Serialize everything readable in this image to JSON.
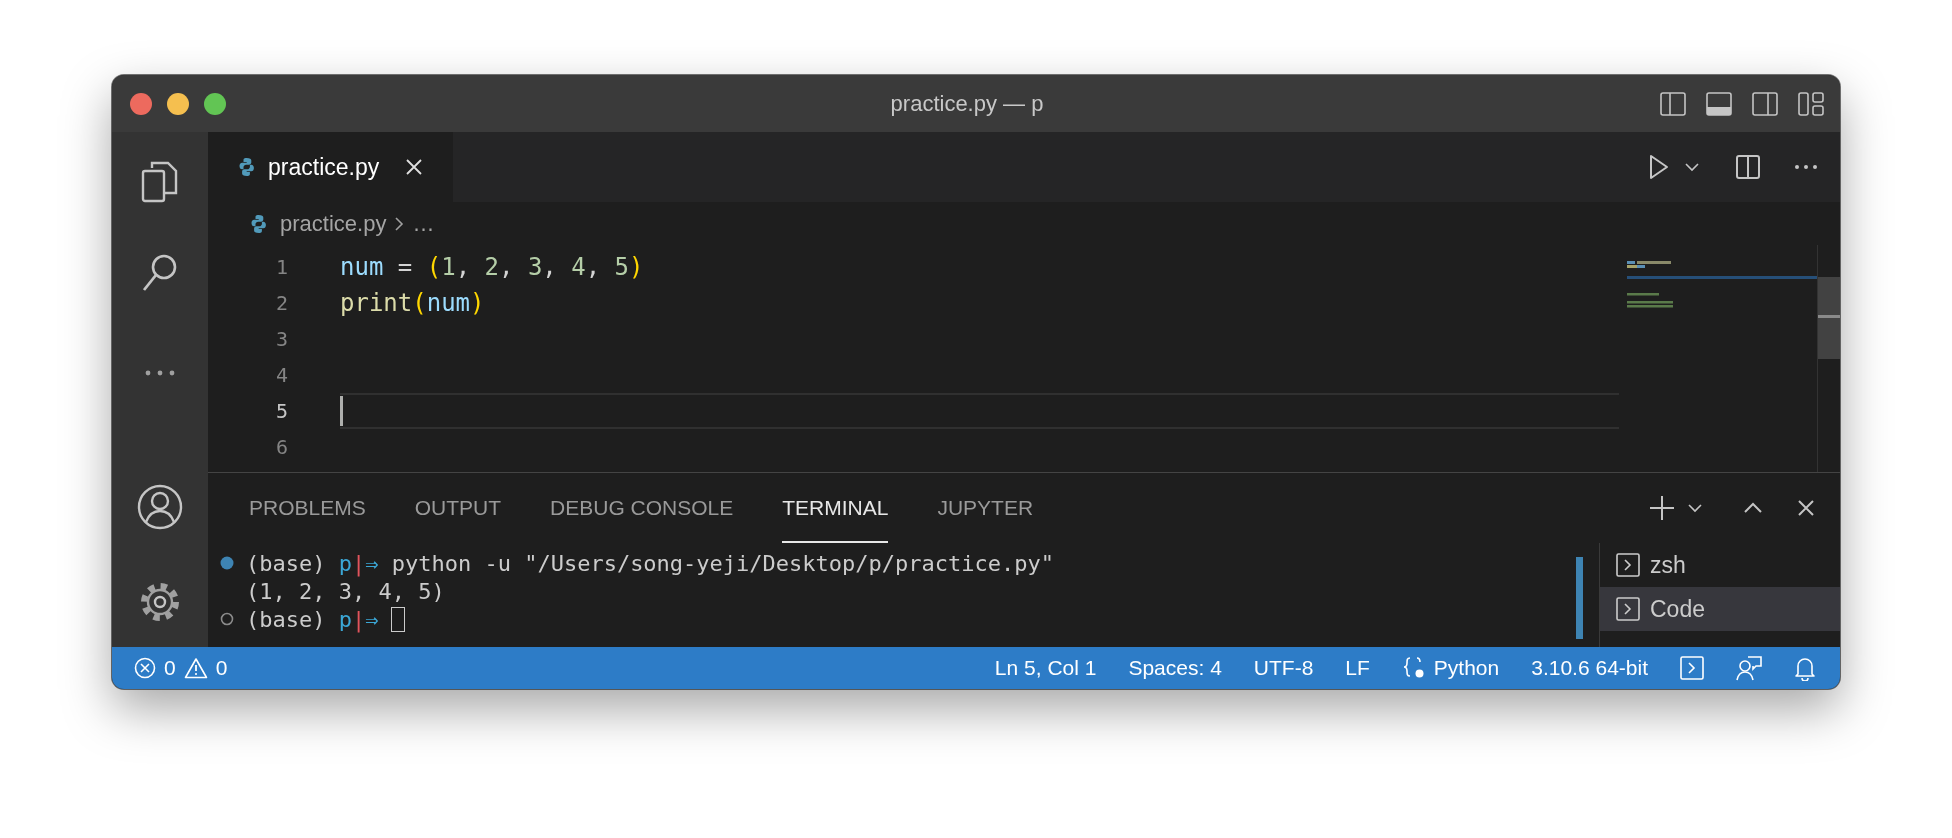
{
  "window": {
    "title": "practice.py — p"
  },
  "tabs": [
    {
      "label": "practice.py",
      "selected": true
    }
  ],
  "breadcrumb": [
    "practice.py",
    "…"
  ],
  "editor": {
    "lines": [
      {
        "number": "1",
        "current": false,
        "tokens": [
          {
            "text": "num",
            "kind": "variable"
          },
          {
            "text": " = ",
            "kind": "operator"
          },
          {
            "text": "(",
            "kind": "paren"
          },
          {
            "text": "1",
            "kind": "number"
          },
          {
            "text": ", ",
            "kind": "operator"
          },
          {
            "text": "2",
            "kind": "number"
          },
          {
            "text": ", ",
            "kind": "operator"
          },
          {
            "text": "3",
            "kind": "number"
          },
          {
            "text": ", ",
            "kind": "operator"
          },
          {
            "text": "4",
            "kind": "number"
          },
          {
            "text": ", ",
            "kind": "operator"
          },
          {
            "text": "5",
            "kind": "number"
          },
          {
            "text": ")",
            "kind": "paren"
          }
        ]
      },
      {
        "number": "2",
        "current": false,
        "tokens": [
          {
            "text": "print",
            "kind": "function"
          },
          {
            "text": "(",
            "kind": "paren"
          },
          {
            "text": "num",
            "kind": "variable"
          },
          {
            "text": ")",
            "kind": "paren"
          }
        ]
      },
      {
        "number": "3",
        "current": false
      },
      {
        "number": "4",
        "current": false
      },
      {
        "number": "5",
        "current": true
      },
      {
        "number": "6",
        "current": false
      }
    ]
  },
  "panel": {
    "tabs": [
      {
        "label": "PROBLEMS",
        "selected": false
      },
      {
        "label": "OUTPUT",
        "selected": false
      },
      {
        "label": "DEBUG CONSOLE",
        "selected": false
      },
      {
        "label": "TERMINAL",
        "selected": true
      },
      {
        "label": "JUPYTER",
        "selected": false
      }
    ],
    "terminal": [
      {
        "succeeded": true,
        "cursor": false,
        "segments": [
          {
            "text": "(base) ",
            "kind": "plain"
          },
          {
            "text": "p",
            "kind": "dir"
          },
          {
            "text": "|",
            "kind": "sep"
          },
          {
            "text": "⇒",
            "kind": "dir"
          },
          {
            "text": " python -u \"/Users/song-yeji/Desktop/p/practice.py\"",
            "kind": "plain"
          }
        ]
      },
      {
        "segments": [
          {
            "text": "(1, 2, 3, 4, 5)",
            "kind": "plain"
          }
        ],
        "cursor": false
      },
      {
        "succeeded": false,
        "cursor": true,
        "segments": [
          {
            "text": "(base) ",
            "kind": "plain"
          },
          {
            "text": "p",
            "kind": "dir"
          },
          {
            "text": "|",
            "kind": "sep"
          },
          {
            "text": "⇒",
            "kind": "dir"
          }
        ]
      }
    ],
    "sessions": [
      {
        "label": "zsh",
        "selected": false
      },
      {
        "label": "Code",
        "selected": true
      }
    ]
  },
  "status_bar": {
    "errors": "0",
    "warnings": "0",
    "items": [
      {
        "text": "Ln 5, Col 1"
      },
      {
        "text": "Spaces: 4"
      },
      {
        "text": "UTF-8"
      },
      {
        "text": "LF"
      },
      {
        "text": "Python",
        "kind": "language"
      },
      {
        "text": "3.10.6 64-bit"
      }
    ]
  }
}
